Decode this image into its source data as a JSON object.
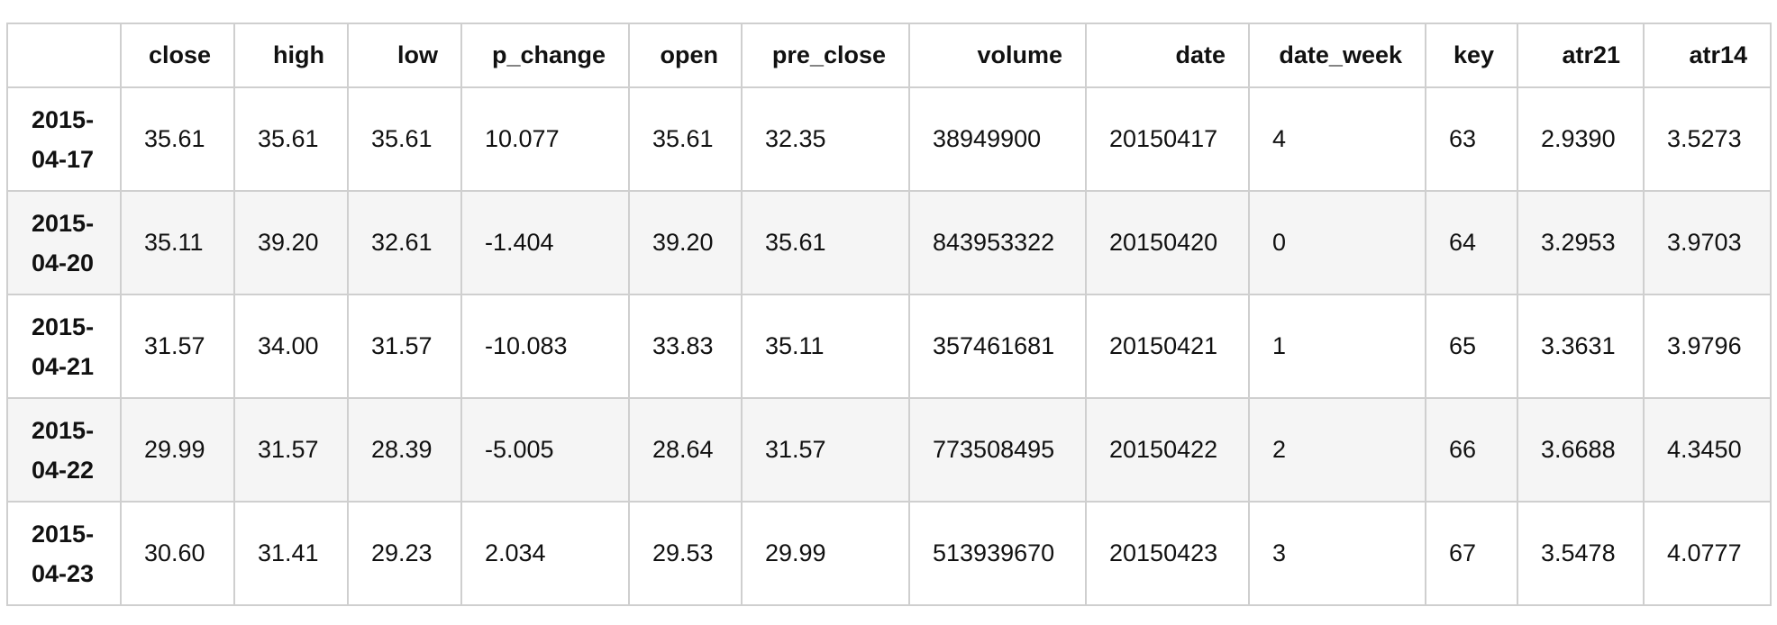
{
  "table": {
    "columns": [
      "close",
      "high",
      "low",
      "p_change",
      "open",
      "pre_close",
      "volume",
      "date",
      "date_week",
      "key",
      "atr21",
      "atr14"
    ],
    "rows": [
      {
        "index": [
          "2015-",
          "04-17"
        ],
        "cells": [
          "35.61",
          "35.61",
          "35.61",
          "10.077",
          "35.61",
          "32.35",
          "38949900",
          "20150417",
          "4",
          "63",
          "2.9390",
          "3.5273"
        ]
      },
      {
        "index": [
          "2015-",
          "04-20"
        ],
        "cells": [
          "35.11",
          "39.20",
          "32.61",
          "-1.404",
          "39.20",
          "35.61",
          "843953322",
          "20150420",
          "0",
          "64",
          "3.2953",
          "3.9703"
        ]
      },
      {
        "index": [
          "2015-",
          "04-21"
        ],
        "cells": [
          "31.57",
          "34.00",
          "31.57",
          "-10.083",
          "33.83",
          "35.11",
          "357461681",
          "20150421",
          "1",
          "65",
          "3.3631",
          "3.9796"
        ]
      },
      {
        "index": [
          "2015-",
          "04-22"
        ],
        "cells": [
          "29.99",
          "31.57",
          "28.39",
          "-5.005",
          "28.64",
          "31.57",
          "773508495",
          "20150422",
          "2",
          "66",
          "3.6688",
          "4.3450"
        ]
      },
      {
        "index": [
          "2015-",
          "04-23"
        ],
        "cells": [
          "30.60",
          "31.41",
          "29.23",
          "2.034",
          "29.53",
          "29.99",
          "513939670",
          "20150423",
          "3",
          "67",
          "3.5478",
          "4.0777"
        ]
      }
    ]
  }
}
